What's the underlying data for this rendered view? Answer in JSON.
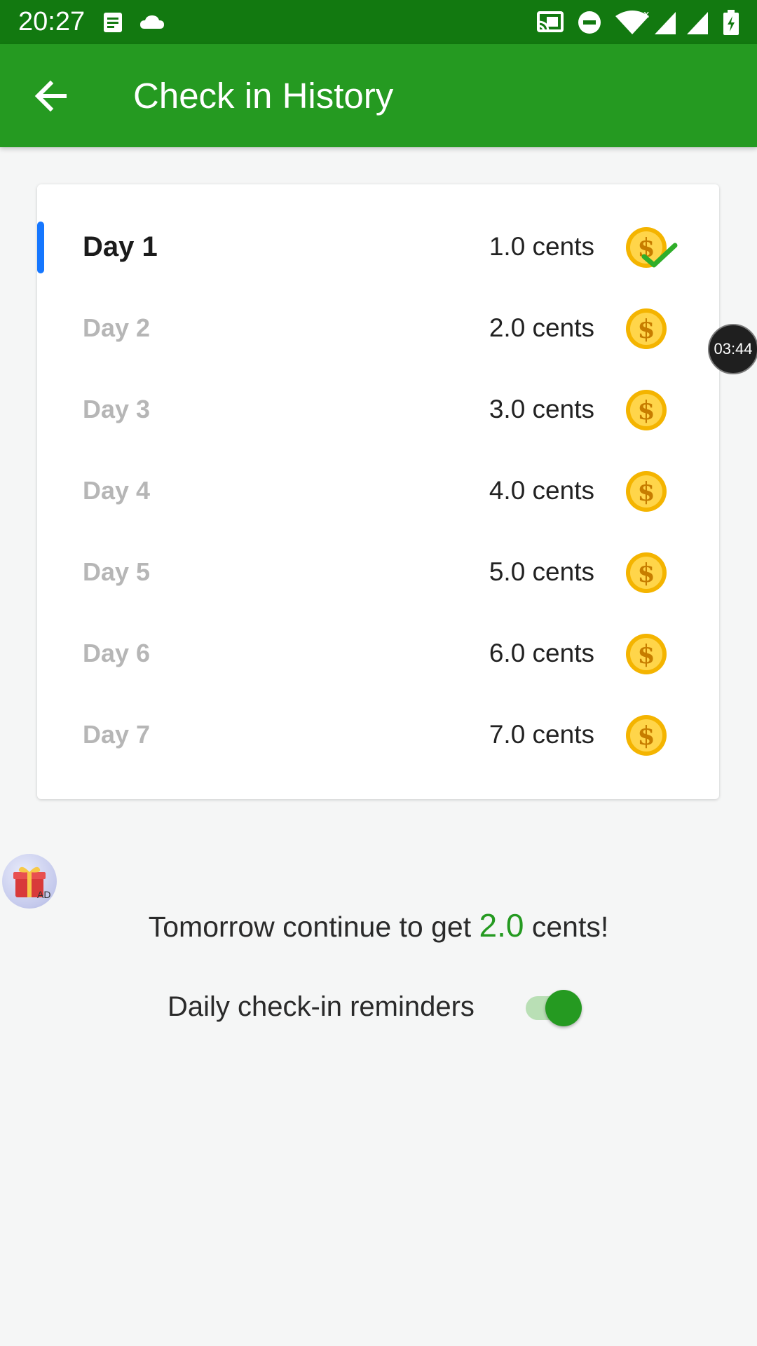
{
  "status_bar": {
    "time": "20:27",
    "icons": [
      "notes-icon",
      "cloud-icon",
      "cast-icon",
      "do-not-disturb-icon",
      "wifi-icon",
      "signal-icon",
      "signal-icon",
      "battery-charging-icon"
    ]
  },
  "app_bar": {
    "title": "Check in History",
    "back_icon": "arrow-back-icon"
  },
  "colors": {
    "status_bar": "#127910",
    "app_bar": "#259a21",
    "accent": "#259a21",
    "indicator": "#1677ff"
  },
  "check_in": {
    "days": [
      {
        "label": "Day 1",
        "amount": "1.0 cents",
        "checked": true
      },
      {
        "label": "Day 2",
        "amount": "2.0 cents",
        "checked": false
      },
      {
        "label": "Day 3",
        "amount": "3.0 cents",
        "checked": false
      },
      {
        "label": "Day 4",
        "amount": "4.0 cents",
        "checked": false
      },
      {
        "label": "Day 5",
        "amount": "5.0 cents",
        "checked": false
      },
      {
        "label": "Day 6",
        "amount": "6.0 cents",
        "checked": false
      },
      {
        "label": "Day 7",
        "amount": "7.0 cents",
        "checked": false
      }
    ]
  },
  "timer": {
    "text": "03:44"
  },
  "ad": {
    "tag": "AD"
  },
  "tomorrow": {
    "prefix": "Tomorrow continue to get ",
    "amount": "2.0",
    "suffix": " cents!"
  },
  "reminder": {
    "label": "Daily check-in reminders",
    "enabled": true
  }
}
